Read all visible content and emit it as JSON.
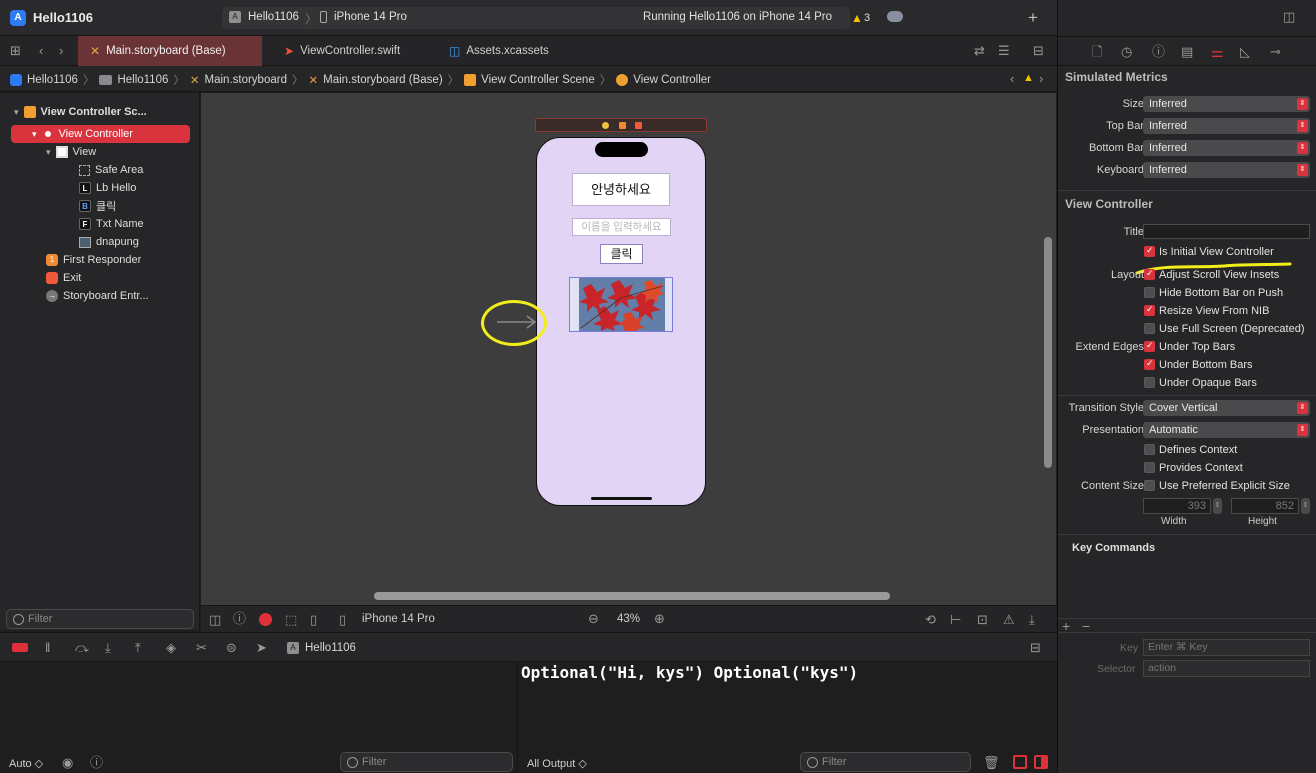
{
  "app": {
    "project": "Hello1106",
    "scheme_project": "Hello1106",
    "device": "iPhone 14 Pro",
    "status": "Running Hello1106 on iPhone 14 Pro",
    "warning_count": "3"
  },
  "tabs": [
    {
      "label": "Main.storyboard (Base)",
      "icon": "storyboard-icon"
    },
    {
      "label": "ViewController.swift",
      "icon": "swift-icon"
    },
    {
      "label": "Assets.xcassets",
      "icon": "assets-icon"
    }
  ],
  "breadcrumb": [
    "Hello1106",
    "Hello1106",
    "Main.storyboard",
    "Main.storyboard (Base)",
    "View Controller Scene",
    "View Controller"
  ],
  "outline": {
    "scene": "View Controller Sc...",
    "controller": "View Controller",
    "view": "View",
    "children": [
      {
        "badge": "",
        "label": "Safe Area"
      },
      {
        "badge": "L",
        "label": "Lb Hello"
      },
      {
        "badge": "B",
        "label": "클릭"
      },
      {
        "badge": "F",
        "label": "Txt Name"
      },
      {
        "badge": "",
        "label": "dnapung"
      }
    ],
    "first_responder": "First Responder",
    "exit": "Exit",
    "entry": "Storyboard Entr...",
    "first_responder_badge": "1"
  },
  "storyboard": {
    "label_text": "안녕하세요",
    "textfield_placeholder": "이름을 입력하세요",
    "button_label": "클릭",
    "image_name": "dnapung"
  },
  "canvas_bar": {
    "device": "iPhone 14 Pro",
    "zoom": "43%"
  },
  "filters": {
    "navigator": "Filter",
    "variables": "Filter",
    "console": "Filter"
  },
  "debug": {
    "project": "Hello1106",
    "auto_label": "Auto ◇",
    "output_label": "All Output ◇"
  },
  "console_output": "Optional(\"Hi, kys\") Optional(\"kys\")",
  "inspector": {
    "simulated_metrics_title": "Simulated Metrics",
    "metrics": [
      {
        "label": "Size",
        "value": "Inferred"
      },
      {
        "label": "Top Bar",
        "value": "Inferred"
      },
      {
        "label": "Bottom Bar",
        "value": "Inferred"
      },
      {
        "label": "Keyboard",
        "value": "Inferred"
      }
    ],
    "vc_title": "View Controller",
    "title_label": "Title",
    "title_value": "",
    "initial_vc": {
      "label": "Is Initial View Controller",
      "checked": true
    },
    "layout_label": "Layout",
    "layout_checks": [
      {
        "label": "Adjust Scroll View Insets",
        "checked": true
      },
      {
        "label": "Hide Bottom Bar on Push",
        "checked": false
      },
      {
        "label": "Resize View From NIB",
        "checked": true
      },
      {
        "label": "Use Full Screen (Deprecated)",
        "checked": false
      }
    ],
    "extend_label": "Extend Edges",
    "extend_checks": [
      {
        "label": "Under Top Bars",
        "checked": true
      },
      {
        "label": "Under Bottom Bars",
        "checked": true
      },
      {
        "label": "Under Opaque Bars",
        "checked": false
      }
    ],
    "transition_label": "Transition Style",
    "transition_value": "Cover Vertical",
    "presentation_label": "Presentation",
    "presentation_value": "Automatic",
    "context_checks": [
      {
        "label": "Defines Context",
        "checked": false
      },
      {
        "label": "Provides Context",
        "checked": false
      }
    ],
    "content_size_label": "Content Size",
    "content_size_check": {
      "label": "Use Preferred Explicit Size",
      "checked": false
    },
    "width_value": "393",
    "height_value": "852",
    "width_label": "Width",
    "height_label": "Height",
    "key_commands_title": "Key Commands",
    "key_label": "Key",
    "key_placeholder": "Enter ⌘ Key",
    "selector_label": "Selector",
    "selector_placeholder": "action"
  },
  "colors": {
    "accent": "#d9343e",
    "selection": "#d9343e",
    "canvas_bg": "#3d3d3d",
    "phone_bg": "#e2d4f4",
    "annotation": "#f2ee1b"
  }
}
